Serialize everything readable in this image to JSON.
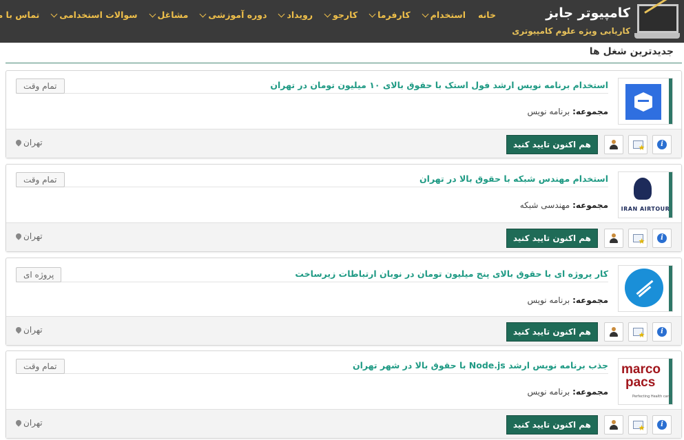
{
  "header": {
    "site_title": "کامپیوتر جابز",
    "site_subtitle": "کاریابی ویژه علوم کامپیوتری",
    "nav": [
      {
        "label": "خانه",
        "has_dropdown": false
      },
      {
        "label": "استخدام",
        "has_dropdown": true
      },
      {
        "label": "کارفرما",
        "has_dropdown": true
      },
      {
        "label": "کارجو",
        "has_dropdown": true
      },
      {
        "label": "رویداد",
        "has_dropdown": true
      },
      {
        "label": "دوره آموزشی",
        "has_dropdown": true
      },
      {
        "label": "مشاغل",
        "has_dropdown": true
      },
      {
        "label": "سوالات استخدامی",
        "has_dropdown": true
      },
      {
        "label": "تماس با ما",
        "has_dropdown": true
      }
    ]
  },
  "section_title": "جدیدترین شغل ها",
  "category_label": "مجموعه:",
  "confirm_label": "هم اکنون تایید کنید",
  "jobs": [
    {
      "title": "استخدام برنامه نویس ارشد فول استک با حقوق بالای ۱۰ میلیون تومان در تهران",
      "type": "تمام وقت",
      "category": "برنامه نویس",
      "location": "تهران"
    },
    {
      "title": "استخدام مهندس شبکه با حقوق بالا در تهران",
      "type": "تمام وقت",
      "category": "مهندسی شبکه",
      "location": "تهران",
      "logo_text": "IRAN AIRTOUR"
    },
    {
      "title": "کار پروژه ای با حقوق بالای پنج میلیون تومان در نوبان ارتباطات زیرساخت",
      "type": "پروژه ای",
      "category": "برنامه نویس",
      "location": "تهران"
    },
    {
      "title": "جذب برنامه نویس ارشد Node.js با حقوق بالا در شهر تهران",
      "type": "تمام وقت",
      "category": "برنامه نویس",
      "location": "تهران",
      "logo_text_top": "marco",
      "logo_text_bottom": "pacs",
      "logo_tagline": "Perfecting Health care"
    }
  ],
  "colors": {
    "header_bg": "#3a3a3a",
    "nav_text": "#f0c04a",
    "title_green": "#1f9a84",
    "button_green": "#1f6b57"
  }
}
